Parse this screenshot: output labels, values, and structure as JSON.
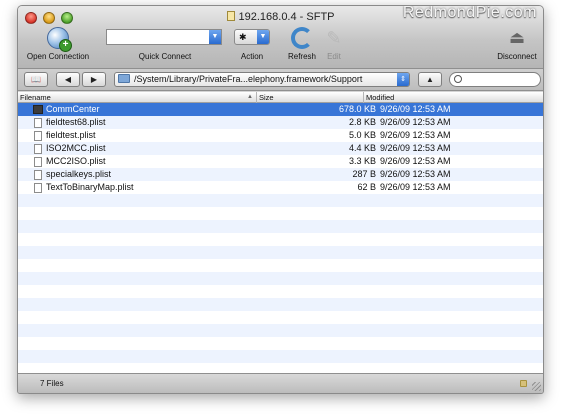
{
  "window": {
    "title": "192.168.0.4 - SFTP",
    "watermark": "RedmondPie.com"
  },
  "toolbar": {
    "open_connection_label": "Open Connection",
    "quick_connect_label": "Quick Connect",
    "quick_connect_value": "",
    "action_label": "Action",
    "refresh_label": "Refresh",
    "edit_label": "Edit",
    "disconnect_label": "Disconnect"
  },
  "pathbar": {
    "back_glyph": "◀",
    "forward_glyph": "▶",
    "up_glyph": "▲",
    "path": "/System/Library/PrivateFra...elephony.framework/Support",
    "search_value": ""
  },
  "columns": {
    "filename": "Filename",
    "size": "Size",
    "modified": "Modified"
  },
  "files": [
    {
      "name": "CommCenter",
      "size": "678.0 KB",
      "modified": "9/26/09 12:53 AM",
      "icon": "executable-icon",
      "selected": true
    },
    {
      "name": "fieldtest68.plist",
      "size": "2.8 KB",
      "modified": "9/26/09 12:53 AM",
      "icon": "document-icon",
      "selected": false
    },
    {
      "name": "fieldtest.plist",
      "size": "5.0 KB",
      "modified": "9/26/09 12:53 AM",
      "icon": "document-icon",
      "selected": false
    },
    {
      "name": "ISO2MCC.plist",
      "size": "4.4 KB",
      "modified": "9/26/09 12:53 AM",
      "icon": "document-icon",
      "selected": false
    },
    {
      "name": "MCC2ISO.plist",
      "size": "3.3 KB",
      "modified": "9/26/09 12:53 AM",
      "icon": "document-icon",
      "selected": false
    },
    {
      "name": "specialkeys.plist",
      "size": "287 B",
      "modified": "9/26/09 12:53 AM",
      "icon": "document-icon",
      "selected": false
    },
    {
      "name": "TextToBinaryMap.plist",
      "size": "62 B",
      "modified": "9/26/09 12:53 AM",
      "icon": "document-icon",
      "selected": false
    }
  ],
  "status": {
    "file_count": "7 Files"
  },
  "colors": {
    "selection": "#3875d7",
    "alt_row": "#edf3fe"
  }
}
